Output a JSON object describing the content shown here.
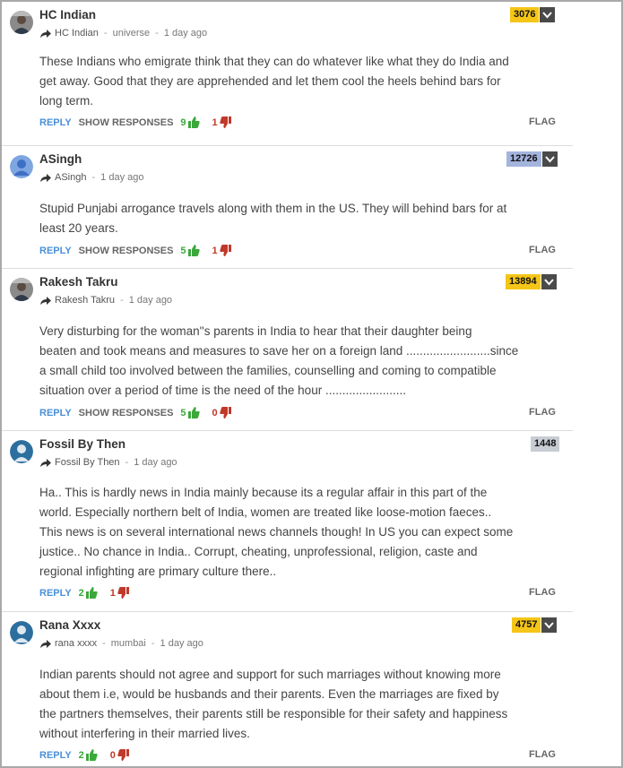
{
  "labels": {
    "reply": "REPLY",
    "show_responses": "SHOW RESPONSES",
    "flag": "FLAG"
  },
  "colors": {
    "reply": "#4a90d9",
    "upvote": "#3aa93a",
    "downvote": "#c0392b",
    "badge_gold": "#f5c518",
    "badge_blue": "#a3b4dd",
    "badge_gray": "#c8cdd3"
  },
  "comments": [
    {
      "name": "HC Indian",
      "author": "HC Indian",
      "location": "universe",
      "time": "1 day ago",
      "points": "3076",
      "badge_color": "#f5c518",
      "text": "These Indians who emigrate think that they can do whatever like what they do India and\nget away. Good that they are apprehended and let them cool the heels behind bars for\nlong term.",
      "upvotes": "9",
      "downvotes": "1",
      "show_responses": true,
      "avatar_icon": "photo-avatar-icon"
    },
    {
      "name": "ASingh",
      "author": "ASingh",
      "location": "",
      "time": "1 day ago",
      "points": "12726",
      "badge_color": "#a3b4dd",
      "text": "Stupid Punjabi arrogance travels along with them in the US. They will behind bars for at\nleast 20 years.",
      "upvotes": "5",
      "downvotes": "1",
      "show_responses": true,
      "avatar_icon": "default-user-icon"
    },
    {
      "name": "Rakesh Takru",
      "author": "Rakesh Takru",
      "location": "",
      "time": "1 day ago",
      "points": "13894",
      "badge_color": "#f5c518",
      "text": "Very disturbing for the woman''s parents in India to hear that their daughter being\nbeaten and took means and measures to save her on a foreign land .........................since\na small child too involved between the families, counselling and coming to compatible\nsituation over a period of time is the need of the hour ........................",
      "upvotes": "5",
      "downvotes": "0",
      "show_responses": true,
      "avatar_icon": "photo-avatar-icon"
    },
    {
      "name": "Fossil By Then",
      "author": "Fossil By Then",
      "location": "",
      "time": "1 day ago",
      "points": "1448",
      "badge_color": "#c8cdd3",
      "text": "Ha.. This is hardly news in India mainly because its a regular affair in this part of the\nworld. Especially northern belt of India, women are treated like loose-motion faeces..\nThis news is on several international news channels though! In US you can expect some\njustice.. No chance in India.. Corrupt, cheating, unprofessional, religion, caste and\nregional infighting are primary culture there..",
      "upvotes": "2",
      "downvotes": "1",
      "show_responses": false,
      "avatar_icon": "silhouette-avatar-icon"
    },
    {
      "name": "Rana Xxxx",
      "author": "rana xxxx",
      "location": "mumbai",
      "time": "1 day ago",
      "points": "4757",
      "badge_color": "#f5c518",
      "text": "Indian parents should not agree and support for such marriages without knowing more\nabout them i.e, would be husbands and their parents. Even the marriages are fixed by\nthe partners themselves, their parents still be responsible for their safety and happiness\nwithout interfering in their married lives.",
      "upvotes": "2",
      "downvotes": "0",
      "show_responses": false,
      "avatar_icon": "silhouette-avatar-icon"
    }
  ]
}
